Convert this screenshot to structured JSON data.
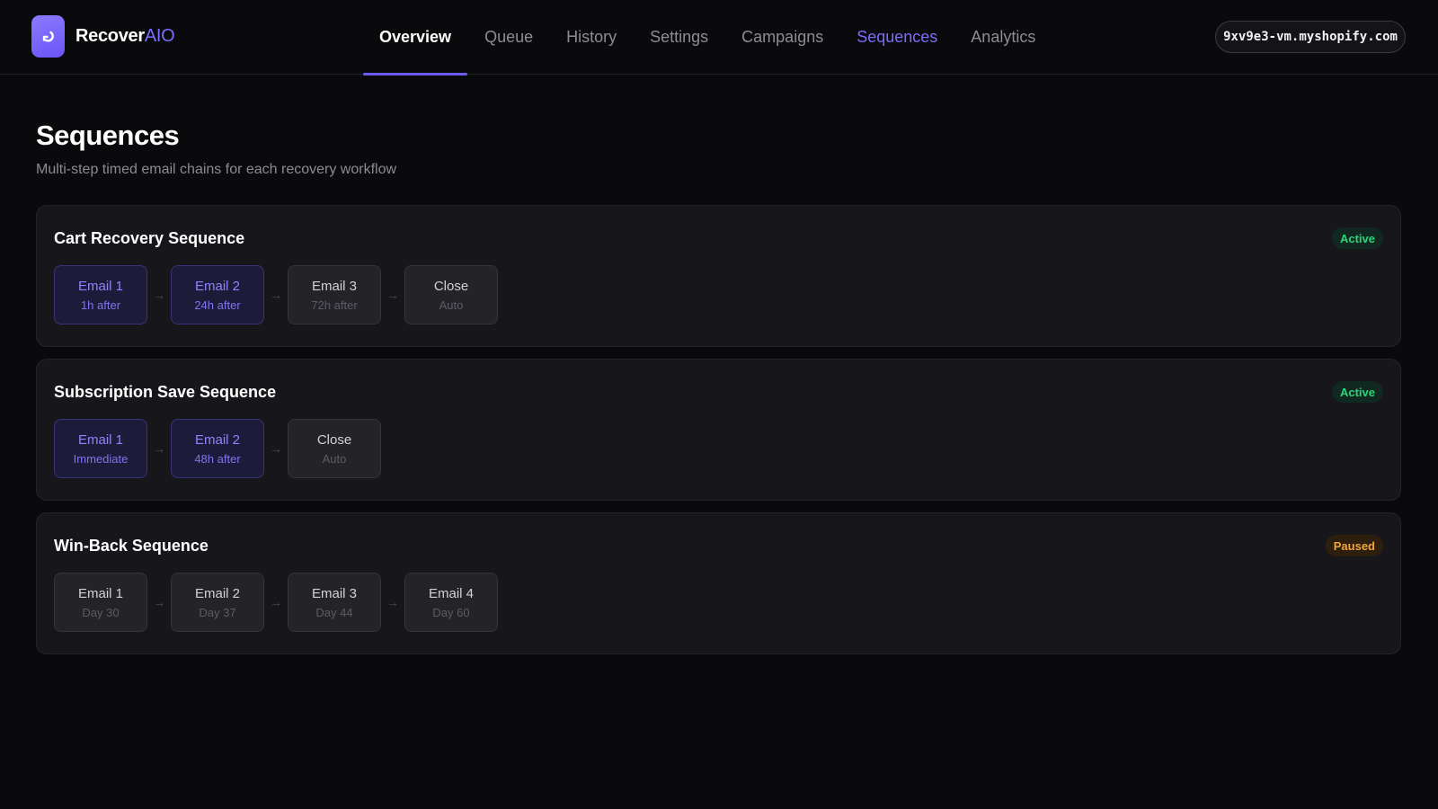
{
  "app": {
    "brand_part1": "Recover",
    "brand_part2": "AIO",
    "logo_icon": "return-arrow-icon",
    "accent_color": "#6b5cf6"
  },
  "nav": {
    "tabs": [
      {
        "label": "Overview",
        "state": "active"
      },
      {
        "label": "Queue",
        "state": "normal"
      },
      {
        "label": "History",
        "state": "normal"
      },
      {
        "label": "Settings",
        "state": "normal"
      },
      {
        "label": "Campaigns",
        "state": "normal"
      },
      {
        "label": "Sequences",
        "state": "accent"
      },
      {
        "label": "Analytics",
        "state": "normal"
      }
    ]
  },
  "store": {
    "domain": "9xv9e3-vm.myshopify.com"
  },
  "page": {
    "title": "Sequences",
    "subtitle": "Multi-step timed email chains for each recovery workflow"
  },
  "sequences": [
    {
      "title": "Cart Recovery Sequence",
      "status": "Active",
      "status_kind": "active",
      "steps": [
        {
          "label": "Email 1",
          "timing": "1h after",
          "state": "sent"
        },
        {
          "label": "Email 2",
          "timing": "24h after",
          "state": "sent"
        },
        {
          "label": "Email 3",
          "timing": "72h after",
          "state": "pending"
        },
        {
          "label": "Close",
          "timing": "Auto",
          "state": "pending"
        }
      ]
    },
    {
      "title": "Subscription Save Sequence",
      "status": "Active",
      "status_kind": "active",
      "steps": [
        {
          "label": "Email 1",
          "timing": "Immediate",
          "state": "sent"
        },
        {
          "label": "Email 2",
          "timing": "48h after",
          "state": "sent"
        },
        {
          "label": "Close",
          "timing": "Auto",
          "state": "pending"
        }
      ]
    },
    {
      "title": "Win-Back Sequence",
      "status": "Paused",
      "status_kind": "paused",
      "steps": [
        {
          "label": "Email 1",
          "timing": "Day 30",
          "state": "pending"
        },
        {
          "label": "Email 2",
          "timing": "Day 37",
          "state": "pending"
        },
        {
          "label": "Email 3",
          "timing": "Day 44",
          "state": "pending"
        },
        {
          "label": "Email 4",
          "timing": "Day 60",
          "state": "pending"
        }
      ]
    }
  ],
  "arrow_glyph": "→",
  "colors": {
    "active_badge": "#2ed47a",
    "paused_badge": "#f2a23a",
    "sent_step": "#8f84ff"
  }
}
